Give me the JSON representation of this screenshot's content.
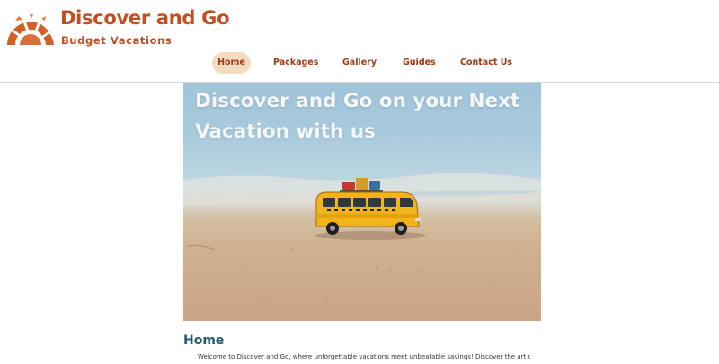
{
  "site": {
    "title": "Discover and Go",
    "subtitle": "Budget Vacations",
    "brand_color": "#c0501f",
    "logo_icon": "sunrise-arc-logo"
  },
  "nav": {
    "items": [
      {
        "label": "Home",
        "active": true
      },
      {
        "label": "Packages",
        "active": false
      },
      {
        "label": "Gallery",
        "active": false
      },
      {
        "label": "Guides",
        "active": false
      },
      {
        "label": "Contact Us",
        "active": false
      }
    ],
    "active_bg": "#f4dcc0",
    "text_color": "#9c3a12"
  },
  "hero": {
    "heading": "Discover and Go on your Next Vacation with us",
    "image": "toy-yellow-van-on-beach"
  },
  "main": {
    "section_heading": "Home",
    "intro_text": "Welcome to Discover and Go, where unforgettable vacations meet unbeatable savings! Discover the art of",
    "heading_color": "#1f5b73"
  }
}
